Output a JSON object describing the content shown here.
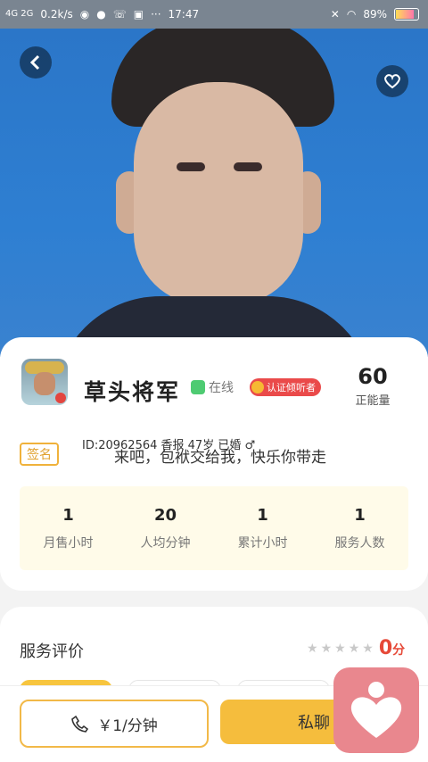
{
  "statusbar": {
    "network": "4G 2G",
    "speed": "0.2k/s",
    "time": "17:47",
    "battery": "89%"
  },
  "profile": {
    "name": "草头将军",
    "online_label": "在线",
    "cert_label": "认证倾听者",
    "energy_value": "60",
    "energy_label": "正能量",
    "sign_label": "签名",
    "id_line": "ID:20962564  香报  47岁 已婚 ♂",
    "motto": "来吧，包袱交给我，快乐你带走"
  },
  "stats": [
    {
      "value": "1",
      "label": "月售小时"
    },
    {
      "value": "20",
      "label": "人均分钟"
    },
    {
      "value": "1",
      "label": "累计小时"
    },
    {
      "value": "1",
      "label": "服务人数"
    }
  ],
  "review": {
    "title": "服务评价",
    "rating_stars": 0,
    "score": "0",
    "score_unit": "分"
  },
  "actions": {
    "call_price": "￥1/分钟",
    "chat_label": "私聊"
  },
  "colors": {
    "accent": "#f5bd3d",
    "score": "#e64938",
    "online": "#4ecb72",
    "cert": "#ea4a4a"
  },
  "icons": {
    "back": "back-arrow-icon",
    "favorite": "heart-icon",
    "phone": "phone-icon",
    "floating": "heart-app-icon"
  }
}
